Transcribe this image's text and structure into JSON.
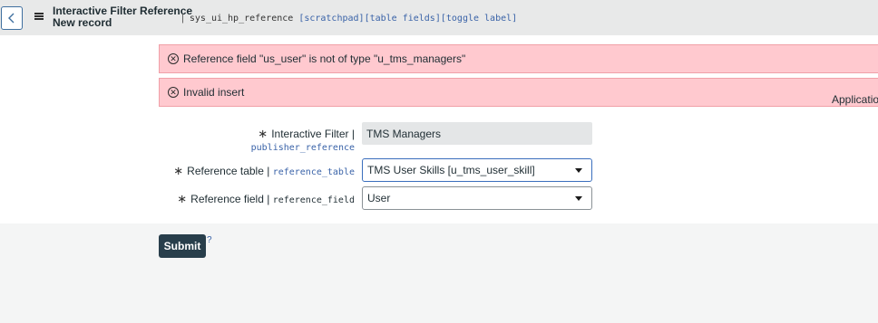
{
  "header": {
    "title_line1": "Interactive Filter Reference",
    "title_line2": "New record",
    "separator": "|",
    "table_name": "sys_ui_hp_reference",
    "links": [
      "[scratchpad]",
      "[table fields]",
      "[toggle label]"
    ]
  },
  "alerts": [
    "Reference field \"us_user\" is not of type \"u_tms_managers\"",
    "Invalid insert"
  ],
  "form": {
    "interactive_filter": {
      "label": "Interactive Filter",
      "separator": " |",
      "field_name": "publisher_reference",
      "value": "TMS Managers"
    },
    "reference_table": {
      "label": "Reference table",
      "separator": " | ",
      "field_name": "reference_table",
      "value": "TMS User Skills [u_tms_user_skill]"
    },
    "reference_field": {
      "label": "Reference field",
      "separator": " | ",
      "field_name": "reference_field",
      "value": "User"
    },
    "application_label": "Applicatio",
    "required_mark": "∗"
  },
  "submit_label": "Submit",
  "help_mark": "?",
  "colors": {
    "header_bg": "#e8e9e9",
    "alert_bg": "#ffc9cf",
    "submit_bg": "#283e4b",
    "link": "#3a63a8",
    "focus_border": "#3a6ebd"
  },
  "icons": {
    "back": "chevron-left-icon",
    "menu": "hamburger-icon",
    "error": "circle-x-icon",
    "dropdown": "caret-down-icon"
  }
}
